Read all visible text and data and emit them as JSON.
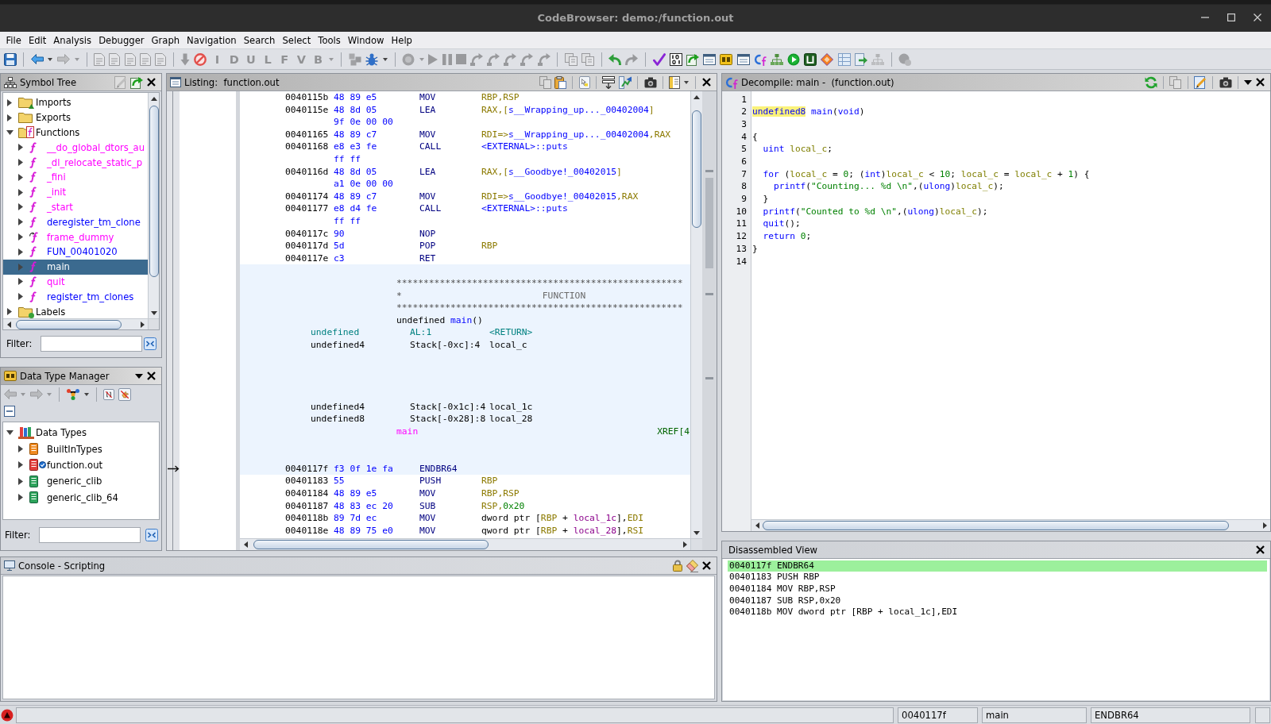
{
  "window": {
    "title": "CodeBrowser: demo:/function.out"
  },
  "menu": [
    "File",
    "Edit",
    "Analysis",
    "Debugger",
    "Graph",
    "Navigation",
    "Search",
    "Select",
    "Tools",
    "Window",
    "Help"
  ],
  "toolbar": [
    [
      {
        "kind": "save",
        "disabled": false
      }
    ],
    [
      {
        "kind": "back",
        "disabled": false
      },
      {
        "kind": "caret",
        "disabled": false
      },
      {
        "kind": "forward",
        "disabled": true
      },
      {
        "kind": "caret",
        "disabled": true
      }
    ],
    [
      {
        "kind": "page",
        "disabled": true
      },
      {
        "kind": "page",
        "disabled": true
      },
      {
        "kind": "page",
        "disabled": true
      },
      {
        "kind": "page",
        "disabled": true
      },
      {
        "kind": "page",
        "disabled": true
      }
    ],
    [
      {
        "kind": "down",
        "disabled": true
      },
      {
        "kind": "noentry",
        "disabled": false
      },
      {
        "kind": "letter",
        "glyph": "I",
        "disabled": true
      },
      {
        "kind": "letter",
        "glyph": "D",
        "disabled": true
      },
      {
        "kind": "letter",
        "glyph": "U",
        "disabled": true
      },
      {
        "kind": "letter",
        "glyph": "L",
        "disabled": true
      },
      {
        "kind": "letter",
        "glyph": "F",
        "disabled": true
      },
      {
        "kind": "letter",
        "glyph": "V",
        "disabled": true
      },
      {
        "kind": "letter",
        "glyph": "B",
        "disabled": true
      },
      {
        "kind": "caret",
        "disabled": true
      }
    ],
    [
      {
        "kind": "chip",
        "disabled": true
      },
      {
        "kind": "bug",
        "disabled": false
      },
      {
        "kind": "caret",
        "disabled": false
      }
    ],
    [
      {
        "kind": "record",
        "disabled": true
      },
      {
        "kind": "caret",
        "disabled": true
      },
      {
        "kind": "play",
        "disabled": true
      },
      {
        "kind": "pause",
        "disabled": true
      },
      {
        "kind": "stop",
        "disabled": true
      },
      {
        "kind": "step",
        "disabled": true
      },
      {
        "kind": "step",
        "disabled": true
      },
      {
        "kind": "step",
        "disabled": true
      },
      {
        "kind": "step",
        "disabled": true
      },
      {
        "kind": "step",
        "disabled": true
      }
    ],
    [
      {
        "kind": "overlap",
        "disabled": true
      },
      {
        "kind": "overlap",
        "disabled": true
      }
    ],
    [
      {
        "kind": "undo",
        "disabled": false
      },
      {
        "kind": "redo",
        "disabled": true
      }
    ],
    [
      {
        "kind": "check",
        "disabled": false
      },
      {
        "kind": "binary",
        "disabled": false
      },
      {
        "kind": "docgo",
        "disabled": false
      },
      {
        "kind": "window",
        "disabled": false
      },
      {
        "kind": "box",
        "disabled": false
      },
      {
        "kind": "window",
        "disabled": false
      },
      {
        "kind": "cf",
        "disabled": false
      },
      {
        "kind": "tree",
        "disabled": false
      },
      {
        "kind": "playcircle",
        "disabled": false
      },
      {
        "kind": "square",
        "disabled": false
      },
      {
        "kind": "diamond",
        "disabled": false
      },
      {
        "kind": "table",
        "disabled": false
      },
      {
        "kind": "docarrow",
        "disabled": false
      },
      {
        "kind": "tree",
        "disabled": true
      }
    ],
    [
      {
        "kind": "bubble",
        "disabled": true
      }
    ]
  ],
  "symbol_tree": {
    "title": "Symbol Tree",
    "buttons": [
      [
        {
          "kind": "edit",
          "disabled": true
        },
        {
          "kind": "docgo",
          "disabled": false
        },
        {
          "kind": "close",
          "disabled": false
        }
      ]
    ],
    "items": [
      {
        "label": "Imports",
        "kind": "imports",
        "expanded": false,
        "selected": false
      },
      {
        "label": "Exports",
        "kind": "exports",
        "expanded": false,
        "selected": false
      },
      {
        "label": "Functions",
        "kind": "functions",
        "expanded": true,
        "selected": false,
        "children": [
          {
            "label": "__do_global_dtors_au",
            "kind": "function",
            "color": "#ff00ff",
            "expanded": false,
            "selected": false
          },
          {
            "label": "_dl_relocate_static_p",
            "kind": "function",
            "color": "#ff00ff",
            "expanded": false,
            "selected": false
          },
          {
            "label": "_fini",
            "kind": "function",
            "color": "#ff00ff",
            "expanded": false,
            "selected": false
          },
          {
            "label": "_init",
            "kind": "function",
            "color": "#ff00ff",
            "expanded": false,
            "selected": false
          },
          {
            "label": "_start",
            "kind": "function",
            "color": "#ff00ff",
            "expanded": false,
            "selected": false
          },
          {
            "label": "deregister_tm_clone",
            "kind": "function",
            "color": "#0000ff",
            "expanded": false,
            "selected": false
          },
          {
            "label": "frame_dummy",
            "kind": "arrow",
            "color": "#ff00ff",
            "expanded": false,
            "selected": false
          },
          {
            "label": "FUN_00401020",
            "kind": "function",
            "color": "#0000ff",
            "expanded": false,
            "selected": false
          },
          {
            "label": "main",
            "kind": "function",
            "expanded": false,
            "selected": true
          },
          {
            "label": "quit",
            "kind": "function",
            "color": "#ff00ff",
            "expanded": false,
            "selected": false
          },
          {
            "label": "register_tm_clones",
            "kind": "function",
            "color": "#0000ff",
            "expanded": false,
            "selected": false
          }
        ]
      },
      {
        "label": "Labels",
        "kind": "labels",
        "expanded": false,
        "selected": false
      }
    ],
    "filter": {
      "label": "Filter:"
    }
  },
  "data_type_manager": {
    "title": "Data Type Manager",
    "buttons": [
      [
        {
          "kind": "triangle",
          "disabled": false
        },
        {
          "kind": "close",
          "disabled": false
        }
      ]
    ],
    "tools": [
      [
        {
          "kind": "back",
          "disabled": true
        },
        {
          "kind": "caret",
          "disabled": true
        },
        {
          "kind": "forward",
          "disabled": true
        },
        {
          "kind": "caret",
          "disabled": true
        }
      ],
      [
        {
          "kind": "colors",
          "disabled": false
        },
        {
          "kind": "caret",
          "disabled": false
        }
      ],
      [
        {
          "kind": "nobrackets",
          "disabled": false,
          "on": true
        },
        {
          "kind": "nopointer",
          "disabled": false,
          "on": true
        }
      ]
    ],
    "tools_row2": [
      [
        {
          "kind": "collapse",
          "disabled": false
        }
      ]
    ],
    "tree": [
      {
        "label": "Data Types",
        "kind": "root",
        "expanded": true,
        "selected": false,
        "children": [
          {
            "label": "BuiltInTypes",
            "kind": "builtin",
            "expanded": false,
            "selected": false
          },
          {
            "label": "function.out",
            "kind": "program",
            "expanded": false,
            "selected": false
          },
          {
            "label": "generic_clib",
            "kind": "archive",
            "expanded": false,
            "selected": false
          },
          {
            "label": "generic_clib_64",
            "kind": "archive",
            "expanded": false,
            "selected": false
          }
        ]
      }
    ],
    "filter": {
      "label": "Filter:"
    }
  },
  "listing": {
    "title": "Listing:  function.out",
    "buttons": [
      [
        {
          "kind": "copy",
          "disabled": true
        },
        {
          "kind": "paste",
          "disabled": false
        }
      ],
      [
        {
          "kind": "pointer",
          "disabled": false,
          "on": true
        }
      ],
      [
        {
          "kind": "fields",
          "disabled": false
        },
        {
          "kind": "diff",
          "disabled": false
        }
      ],
      [
        {
          "kind": "camera",
          "disabled": false
        }
      ],
      [
        {
          "kind": "layout",
          "disabled": false
        },
        {
          "kind": "caret",
          "disabled": false
        }
      ],
      [
        {
          "kind": "close",
          "disabled": false
        }
      ]
    ],
    "blocks": [
      {
        "current": false,
        "rows": [
          {
            "kind": "instruction",
            "address": "0040115b",
            "bytes": "48 89 e5",
            "mnemonic": "MOV",
            "operands": [
              {
                "text": "RBP,RSP",
                "kind": "reg"
              }
            ]
          },
          {
            "kind": "instruction",
            "address": "0040115e",
            "bytes": "48 8d 05",
            "mnemonic": "LEA",
            "operands": [
              {
                "text": "RAX,[",
                "kind": "reg"
              },
              {
                "text": "s__Wrapping_up..._00402004",
                "kind": "label"
              },
              {
                "text": "]",
                "kind": "reg"
              }
            ]
          },
          {
            "kind": "bytes",
            "bytes": "9f 0e 00 00"
          },
          {
            "kind": "instruction",
            "address": "00401165",
            "bytes": "48 89 c7",
            "mnemonic": "MOV",
            "operands": [
              {
                "text": "RDI=>",
                "kind": "reg"
              },
              {
                "text": "s__Wrapping_up..._00402004",
                "kind": "label"
              },
              {
                "text": ",RAX",
                "kind": "reg"
              }
            ]
          },
          {
            "kind": "instruction",
            "address": "00401168",
            "bytes": "e8 e3 fe",
            "mnemonic": "CALL",
            "operands": [
              {
                "text": "<EXTERNAL>::puts",
                "kind": "label"
              }
            ]
          },
          {
            "kind": "bytes",
            "bytes": "ff ff"
          },
          {
            "kind": "instruction",
            "address": "0040116d",
            "bytes": "48 8d 05",
            "mnemonic": "LEA",
            "operands": [
              {
                "text": "RAX,[",
                "kind": "reg"
              },
              {
                "text": "s__Goodbye!_00402015",
                "kind": "label"
              },
              {
                "text": "]",
                "kind": "reg"
              }
            ]
          },
          {
            "kind": "bytes",
            "bytes": "a1 0e 00 00"
          },
          {
            "kind": "instruction",
            "address": "00401174",
            "bytes": "48 89 c7",
            "mnemonic": "MOV",
            "operands": [
              {
                "text": "RDI=>",
                "kind": "reg"
              },
              {
                "text": "s__Goodbye!_00402015",
                "kind": "label"
              },
              {
                "text": ",RAX",
                "kind": "reg"
              }
            ]
          },
          {
            "kind": "instruction",
            "address": "00401177",
            "bytes": "e8 d4 fe",
            "mnemonic": "CALL",
            "operands": [
              {
                "text": "<EXTERNAL>::puts",
                "kind": "label"
              }
            ]
          },
          {
            "kind": "bytes",
            "bytes": "ff ff"
          },
          {
            "kind": "instruction",
            "address": "0040117c",
            "bytes": "90",
            "mnemonic": "NOP"
          },
          {
            "kind": "instruction",
            "address": "0040117d",
            "bytes": "5d",
            "mnemonic": "POP",
            "operands": [
              {
                "text": "RBP",
                "kind": "reg"
              }
            ]
          },
          {
            "kind": "instruction",
            "address": "0040117e",
            "bytes": "c3",
            "mnemonic": "RET"
          }
        ]
      },
      {
        "current": true,
        "rows": [
          {
            "kind": "blank"
          },
          {
            "kind": "stars",
            "text": "*****************************************************"
          },
          {
            "kind": "plate",
            "mark": "*",
            "text": "FUNCTION"
          },
          {
            "kind": "stars",
            "text": "*****************************************************"
          },
          {
            "kind": "signature",
            "tokens": [
              {
                "text": "undefined ",
                "kind": "plain"
              },
              {
                "text": "main",
                "kind": "label"
              },
              {
                "text": "()",
                "kind": "plain"
              }
            ]
          },
          {
            "kind": "return",
            "type": "undefined",
            "storage": "AL:1",
            "name": "<RETURN>"
          },
          {
            "kind": "variable",
            "type": "undefined4",
            "storage": "Stack[-0xc]:4",
            "name": "local_c"
          },
          {
            "kind": "blank"
          },
          {
            "kind": "blank"
          },
          {
            "kind": "blank"
          },
          {
            "kind": "blank"
          },
          {
            "kind": "variable",
            "type": "undefined4",
            "storage": "Stack[-0x1c]:4",
            "name": "local_1c"
          },
          {
            "kind": "variable",
            "type": "undefined8",
            "storage": "Stack[-0x28]:8",
            "name": "local_28"
          },
          {
            "kind": "label",
            "text": "main",
            "xref": "XREF[4"
          },
          {
            "kind": "blank"
          },
          {
            "kind": "blank"
          },
          {
            "kind": "instruction",
            "address": "0040117f",
            "bytes": "f3 0f 1e fa",
            "mnemonic": "ENDBR64"
          }
        ]
      },
      {
        "current": false,
        "rows": [
          {
            "kind": "instruction",
            "address": "00401183",
            "bytes": "55",
            "mnemonic": "PUSH",
            "operands": [
              {
                "text": "RBP",
                "kind": "reg"
              }
            ]
          },
          {
            "kind": "instruction",
            "address": "00401184",
            "bytes": "48 89 e5",
            "mnemonic": "MOV",
            "operands": [
              {
                "text": "RBP,RSP",
                "kind": "reg"
              }
            ]
          },
          {
            "kind": "instruction",
            "address": "00401187",
            "bytes": "48 83 ec 20",
            "mnemonic": "SUB",
            "operands": [
              {
                "text": "RSP,",
                "kind": "reg"
              },
              {
                "text": "0x20",
                "kind": "num"
              }
            ]
          },
          {
            "kind": "instruction",
            "address": "0040118b",
            "bytes": "89 7d ec",
            "mnemonic": "MOV",
            "operands": [
              {
                "text": "dword ptr [",
                "kind": "plain"
              },
              {
                "text": "RBP",
                "kind": "reg"
              },
              {
                "text": " + ",
                "kind": "plain"
              },
              {
                "text": "local_1c",
                "kind": "var"
              },
              {
                "text": "],",
                "kind": "plain"
              },
              {
                "text": "EDI",
                "kind": "reg"
              }
            ]
          },
          {
            "kind": "instruction",
            "address": "0040118e",
            "bytes": "48 89 75 e0",
            "mnemonic": "MOV",
            "operands": [
              {
                "text": "qword ptr [",
                "kind": "plain"
              },
              {
                "text": "RBP",
                "kind": "reg"
              },
              {
                "text": " + ",
                "kind": "plain"
              },
              {
                "text": "local_28",
                "kind": "var"
              },
              {
                "text": "],",
                "kind": "plain"
              },
              {
                "text": "RSI",
                "kind": "reg"
              }
            ]
          }
        ]
      }
    ]
  },
  "decompile": {
    "title": "Decompile: main -  (function.out)",
    "buttons": [
      [
        {
          "kind": "refresh",
          "disabled": false
        }
      ],
      [
        {
          "kind": "copy",
          "disabled": true
        }
      ],
      [
        {
          "kind": "edit",
          "disabled": false
        }
      ],
      [
        {
          "kind": "camera",
          "disabled": false
        }
      ],
      [
        {
          "kind": "triangle",
          "disabled": false
        },
        {
          "kind": "close",
          "disabled": false
        }
      ]
    ],
    "lines": [
      {
        "number": "1"
      },
      {
        "number": "2",
        "tokens": [
          {
            "text": "undefined8",
            "kind": "type",
            "highlighted": true
          },
          {
            "text": " main",
            "kind": "func",
            "highlighted": false
          },
          {
            "text": "(",
            "kind": "plain",
            "highlighted": false
          },
          {
            "text": "void",
            "kind": "type",
            "highlighted": false
          },
          {
            "text": ")",
            "kind": "plain",
            "highlighted": false
          }
        ]
      },
      {
        "number": "3"
      },
      {
        "number": "4",
        "tokens": [
          {
            "text": "{",
            "kind": "plain"
          }
        ]
      },
      {
        "number": "5",
        "tokens": [
          {
            "text": "  uint",
            "kind": "type"
          },
          {
            "text": " local_c",
            "kind": "var"
          },
          {
            "text": ";",
            "kind": "plain"
          }
        ]
      },
      {
        "number": "6"
      },
      {
        "number": "7",
        "tokens": [
          {
            "text": "  for",
            "kind": "keyword"
          },
          {
            "text": " (",
            "kind": "plain"
          },
          {
            "text": "local_c",
            "kind": "var"
          },
          {
            "text": " = ",
            "kind": "plain"
          },
          {
            "text": "0",
            "kind": "num"
          },
          {
            "text": "; (",
            "kind": "plain"
          },
          {
            "text": "int",
            "kind": "type"
          },
          {
            "text": ")",
            "kind": "plain"
          },
          {
            "text": "local_c",
            "kind": "var"
          },
          {
            "text": " < ",
            "kind": "plain"
          },
          {
            "text": "10",
            "kind": "num"
          },
          {
            "text": "; ",
            "kind": "plain"
          },
          {
            "text": "local_c",
            "kind": "var"
          },
          {
            "text": " = ",
            "kind": "plain"
          },
          {
            "text": "local_c",
            "kind": "var"
          },
          {
            "text": " + ",
            "kind": "plain"
          },
          {
            "text": "1",
            "kind": "num"
          },
          {
            "text": ") {",
            "kind": "plain"
          }
        ]
      },
      {
        "number": "8",
        "tokens": [
          {
            "text": "    printf",
            "kind": "func"
          },
          {
            "text": "(",
            "kind": "plain"
          },
          {
            "text": "\"Counting... %d \\n\"",
            "kind": "string"
          },
          {
            "text": ",(",
            "kind": "plain"
          },
          {
            "text": "ulong",
            "kind": "type"
          },
          {
            "text": ")",
            "kind": "plain"
          },
          {
            "text": "local_c",
            "kind": "var"
          },
          {
            "text": ");",
            "kind": "plain"
          }
        ]
      },
      {
        "number": "9",
        "tokens": [
          {
            "text": "  }",
            "kind": "plain"
          }
        ]
      },
      {
        "number": "10",
        "tokens": [
          {
            "text": "  printf",
            "kind": "func"
          },
          {
            "text": "(",
            "kind": "plain"
          },
          {
            "text": "\"Counted to %d \\n\"",
            "kind": "string"
          },
          {
            "text": ",(",
            "kind": "plain"
          },
          {
            "text": "ulong",
            "kind": "type"
          },
          {
            "text": ")",
            "kind": "plain"
          },
          {
            "text": "local_c",
            "kind": "var"
          },
          {
            "text": ");",
            "kind": "plain"
          }
        ]
      },
      {
        "number": "11",
        "tokens": [
          {
            "text": "  quit",
            "kind": "func"
          },
          {
            "text": "();",
            "kind": "plain"
          }
        ]
      },
      {
        "number": "12",
        "tokens": [
          {
            "text": "  return",
            "kind": "keyword"
          },
          {
            "text": " 0",
            "kind": "num"
          },
          {
            "text": ";",
            "kind": "plain"
          }
        ]
      },
      {
        "number": "13",
        "tokens": [
          {
            "text": "}",
            "kind": "plain"
          }
        ]
      },
      {
        "number": "14"
      }
    ]
  },
  "console": {
    "title": "Console - Scripting",
    "buttons": [
      [
        {
          "kind": "lock",
          "disabled": false
        },
        {
          "kind": "eraser",
          "disabled": false
        },
        {
          "kind": "close",
          "disabled": false
        }
      ]
    ]
  },
  "disassembled_view": {
    "title": "Disassembled View",
    "buttons": [
      [
        {
          "kind": "close",
          "disabled": false
        }
      ]
    ],
    "rows": [
      {
        "text": "0040117f ENDBR64",
        "selected": true
      },
      {
        "text": "00401183 PUSH RBP",
        "selected": false
      },
      {
        "text": "00401184 MOV RBP,RSP",
        "selected": false
      },
      {
        "text": "00401187 SUB RSP,0x20",
        "selected": false
      },
      {
        "text": "0040118b MOV dword ptr [RBP + local_1c],EDI",
        "selected": false
      }
    ]
  },
  "status_bar": {
    "fields": [
      "0040117f",
      "main",
      "ENDBR64"
    ]
  }
}
